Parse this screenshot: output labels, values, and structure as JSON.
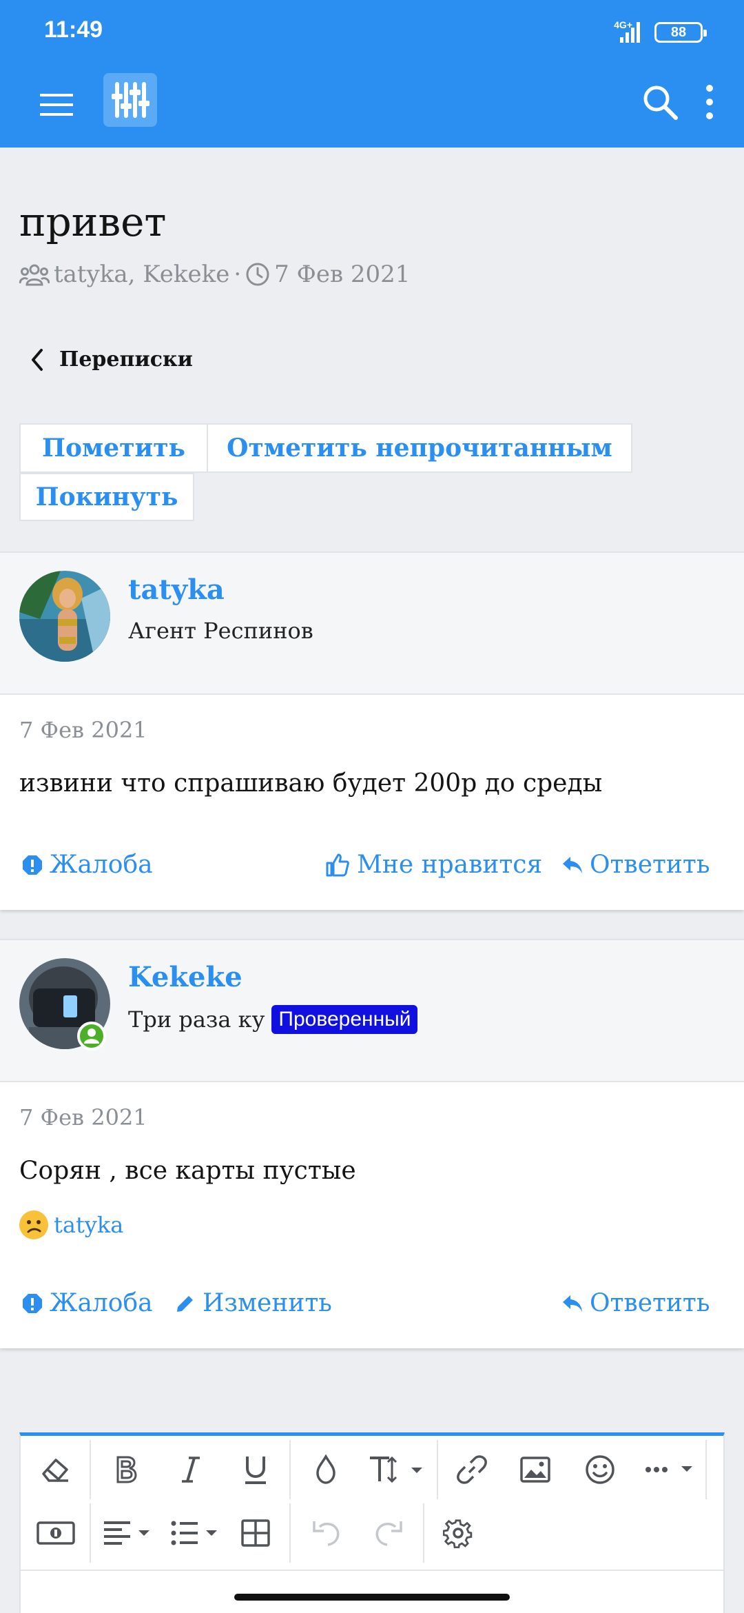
{
  "status_bar": {
    "time": "11:49",
    "network": "4G+",
    "battery": "88"
  },
  "app_bar": {
    "menu_icon": "hamburger-menu-icon",
    "logo_icon": "sliders-logo-icon",
    "search_icon": "search-icon",
    "more_icon": "more-vertical-icon"
  },
  "thread": {
    "title": "привет",
    "participants": "tatyka, Kekeke",
    "separator": "·",
    "date": "7 Фев 2021"
  },
  "back_link": {
    "label": "Переписки"
  },
  "buttons": {
    "mark": "Пометить",
    "mark_unread": "Отметить непрочитанным",
    "leave": "Покинуть"
  },
  "posts": [
    {
      "username": "tatyka",
      "user_title": "Агент Респинов",
      "date": "7 Фев 2021",
      "text": "извини что спрашиваю будет 200р до среды",
      "actions": {
        "report": "Жалоба",
        "like": "Мне нравится",
        "reply": "Ответить"
      }
    },
    {
      "username": "Kekeke",
      "user_title": "Три раза ку",
      "badge": "Проверенный",
      "date": "7 Фев 2021",
      "text": "Сорян , все карты пустые",
      "reaction_user": "tatyka",
      "actions": {
        "report": "Жалоба",
        "edit": "Изменить",
        "reply": "Ответить"
      }
    }
  ],
  "colors": {
    "accent": "#2a8ff0",
    "badge": "#1010e0",
    "online": "#4caf28"
  }
}
